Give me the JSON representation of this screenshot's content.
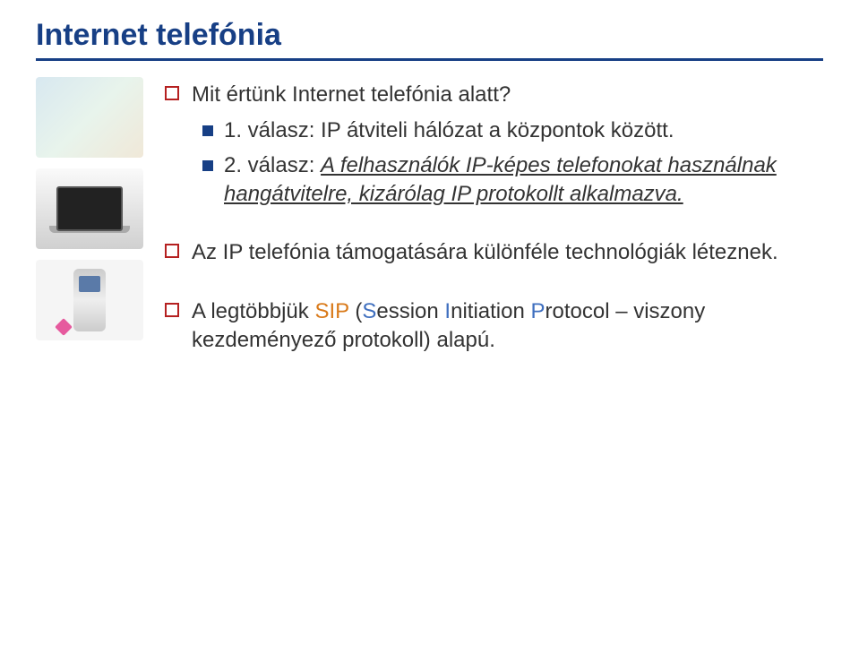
{
  "slide": {
    "title": "Internet telefónia",
    "bullets": {
      "b1": "Mit értünk Internet telefónia alatt?",
      "b2_prefix": "1. válasz: ",
      "b2_rest": "IP átviteli hálózat a központok között.",
      "b3_prefix": "2. válasz: ",
      "b3_italic": "A felhasználók IP-képes telefonokat használnak hangátvitelre, kizárólag IP protokollt alkalmazva.",
      "b4": "Az IP telefónia támogatására különféle technológiák léteznek.",
      "b5_a": "A legtöbbjük ",
      "b5_orange": "SIP",
      "b5_b": " (",
      "b5_blue1": "S",
      "b5_c": "ession ",
      "b5_blue2": "I",
      "b5_d": "nitiation ",
      "b5_blue3": "P",
      "b5_e": "rotocol – viszony kezdeményező protokoll) alapú."
    }
  },
  "thumbs": {
    "t1": "device-collage",
    "t2": "laptop",
    "t3": "mobile-phone"
  }
}
